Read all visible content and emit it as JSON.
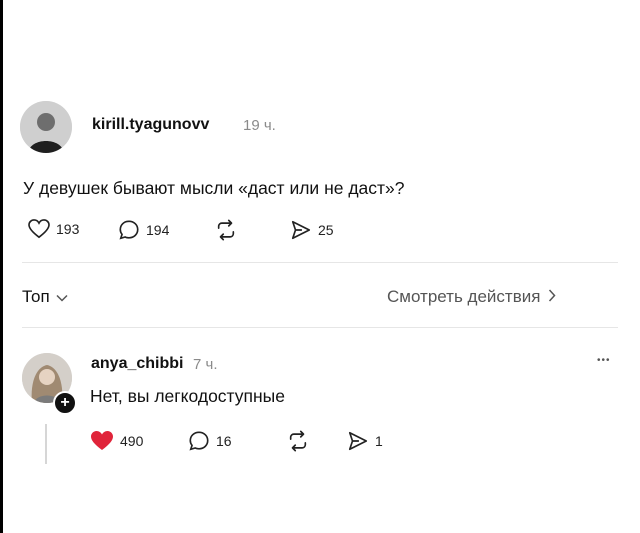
{
  "post": {
    "username": "kirill.tyagunovv",
    "time": "19 ч.",
    "text": "У девушек бывают мысли «даст или не даст»?",
    "likes": "193",
    "comments": "194",
    "shares": "25"
  },
  "replies_bar": {
    "sort_label": "Топ",
    "view_activity_label": "Смотреть действия"
  },
  "reply": {
    "username": "anya_chibbi",
    "time": "7 ч.",
    "text": "Нет, вы легкодоступные",
    "likes": "490",
    "comments": "16",
    "shares": "1",
    "more": "•••"
  },
  "colors": {
    "like_active": "#e0243a",
    "muted_text": "#8a8a8a"
  },
  "icons": [
    "heart-icon",
    "comment-icon",
    "repost-icon",
    "share-icon",
    "chevron-down-icon",
    "chevron-right-icon",
    "plus-icon",
    "more-icon"
  ]
}
